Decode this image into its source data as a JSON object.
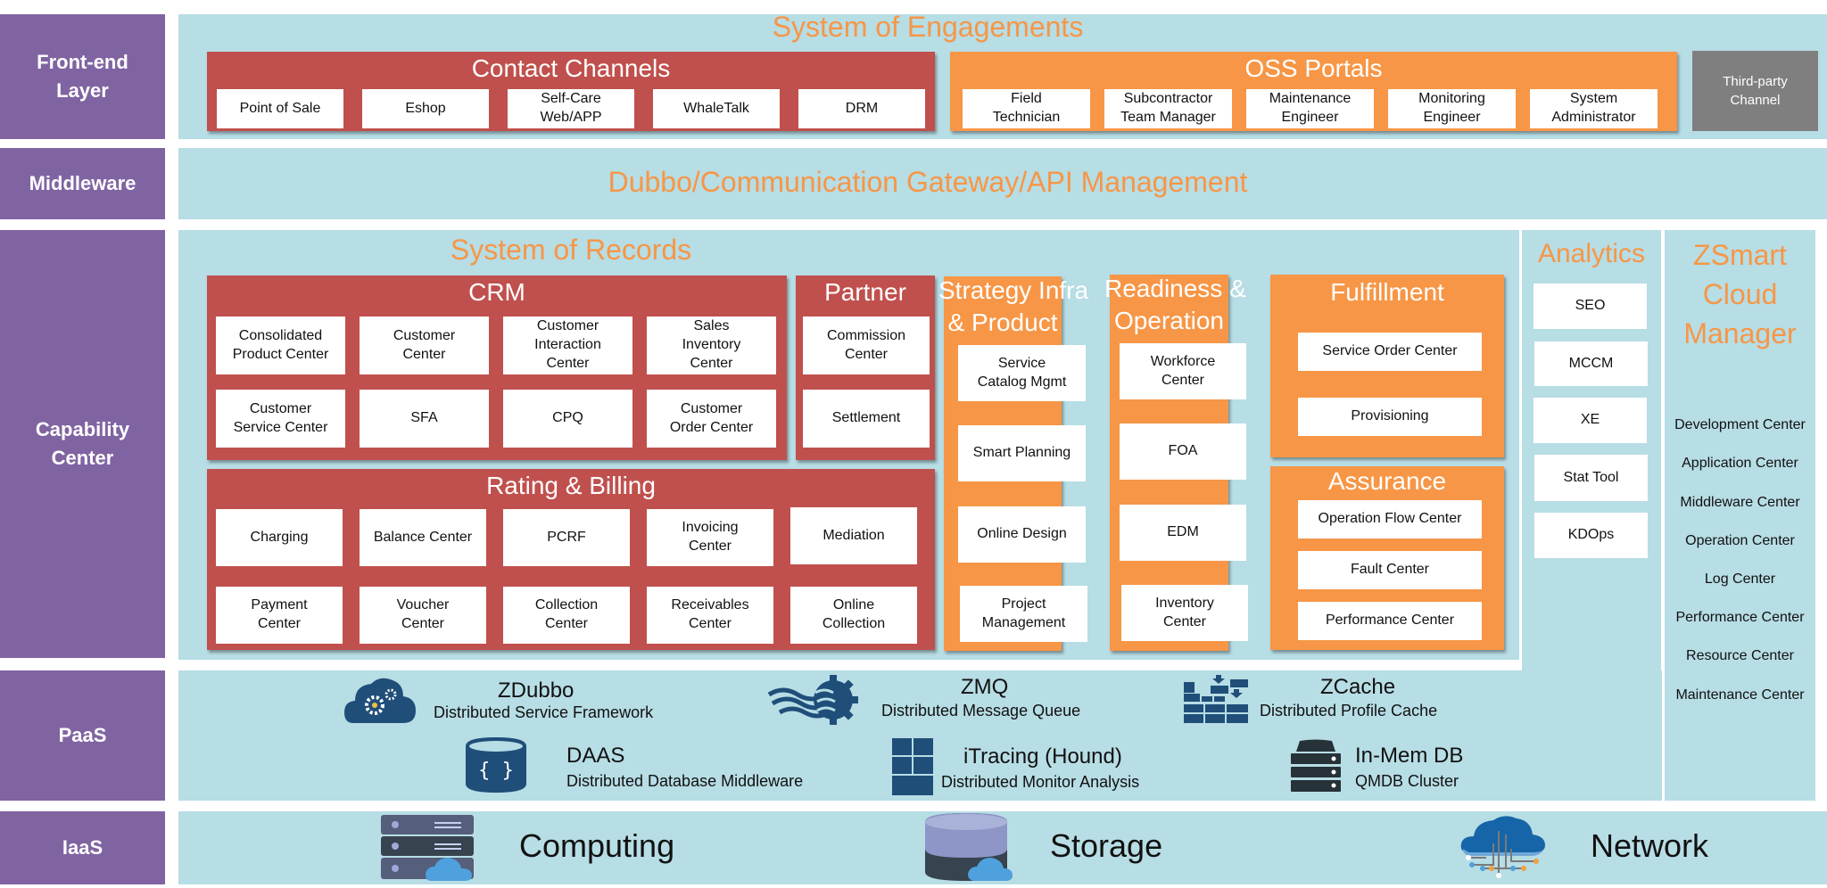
{
  "layers": {
    "frontend": "Front-end\nLayer",
    "middleware": "Middleware",
    "capability": "Capability\nCenter",
    "paas": "PaaS",
    "iaas": "IaaS"
  },
  "engagements": {
    "title": "System of Engagements",
    "contact_channels": {
      "title": "Contact Channels",
      "items": [
        "Point of Sale",
        "Eshop",
        "Self-Care\nWeb/APP",
        "WhaleTalk",
        "DRM"
      ]
    },
    "oss_portals": {
      "title": "OSS Portals",
      "items": [
        "Field\nTechnician",
        "Subcontractor\nTeam Manager",
        "Maintenance\nEngineer",
        "Monitoring\nEngineer",
        "System\nAdministrator"
      ]
    },
    "third_party": "Third-party\nChannel"
  },
  "middleware": {
    "title": "Dubbo/Communication Gateway/API Management"
  },
  "records": {
    "title": "System of Records",
    "crm": {
      "title": "CRM",
      "items": [
        "Consolidated\nProduct Center",
        "Customer\nCenter",
        "Customer\nInteraction\nCenter",
        "Sales\nInventory\nCenter",
        "Customer\nService Center",
        "SFA",
        "CPQ",
        "Customer\nOrder Center"
      ]
    },
    "partner": {
      "title": "Partner",
      "items": [
        "Commission\nCenter",
        "Settlement"
      ]
    },
    "rating_billing": {
      "title": "Rating & Billing",
      "items": [
        "Charging",
        "Balance Center",
        "PCRF",
        "Invoicing\nCenter",
        "Mediation",
        "Payment\nCenter",
        "Voucher\nCenter",
        "Collection\nCenter",
        "Receivables\nCenter",
        "Online\nCollection"
      ]
    },
    "strategy": {
      "title_line1": "Strategy  Infra",
      "title_line2": "& Product",
      "items": [
        "Service\nCatalog Mgmt",
        "Smart Planning",
        "Online Design",
        "Project\nManagement"
      ]
    },
    "readiness": {
      "title_line1": "Readiness &",
      "title_line2": "Operation",
      "items": [
        "Workforce\nCenter",
        "FOA",
        "EDM",
        "Inventory\nCenter"
      ]
    },
    "fulfillment": {
      "title": "Fulfillment",
      "items": [
        "Service Order Center",
        "Provisioning"
      ]
    },
    "assurance": {
      "title": "Assurance",
      "items": [
        "Operation Flow Center",
        "Fault Center",
        "Performance Center"
      ]
    }
  },
  "analytics": {
    "title": "Analytics",
    "items": [
      "SEO",
      "MCCM",
      "XE",
      "Stat Tool",
      "KDOps"
    ]
  },
  "cloud_manager": {
    "title_line1": "ZSmart",
    "title_line2": "Cloud",
    "title_line3": "Manager",
    "items": [
      "Development Center",
      "Application Center",
      "Middleware Center",
      "Operation Center",
      "Log Center",
      "Performance Center",
      "Resource Center",
      "Maintenance Center"
    ]
  },
  "paas": {
    "items": [
      {
        "name": "ZDubbo",
        "desc": "Distributed Service Framework",
        "icon": "cloud-gears-icon"
      },
      {
        "name": "ZMQ",
        "desc": "Distributed Message Queue",
        "icon": "message-queue-gear-icon"
      },
      {
        "name": "ZCache",
        "desc": "Distributed Profile Cache",
        "icon": "brick-cache-icon"
      },
      {
        "name": "DAAS",
        "desc": "Distributed Database  Middleware",
        "icon": "database-braces-icon"
      },
      {
        "name": "iTracing (Hound)",
        "desc": "Distributed Monitor Analysis",
        "icon": "tiles-icon"
      },
      {
        "name": "In-Mem DB",
        "desc": "QMDB Cluster",
        "icon": "server-stack-icon"
      }
    ]
  },
  "iaas": {
    "items": [
      {
        "name": "Computing",
        "icon": "server-cloud-icon"
      },
      {
        "name": "Storage",
        "icon": "storage-cloud-icon"
      },
      {
        "name": "Network",
        "icon": "network-cloud-icon"
      }
    ]
  },
  "colors": {
    "layer_label": "#8064a2",
    "panel": "#b7dde5",
    "accent_orange": "#f79646",
    "group_red": "#c0504d",
    "third_party_gray": "#7f7f7f",
    "icon_blue": "#1f4e79"
  }
}
